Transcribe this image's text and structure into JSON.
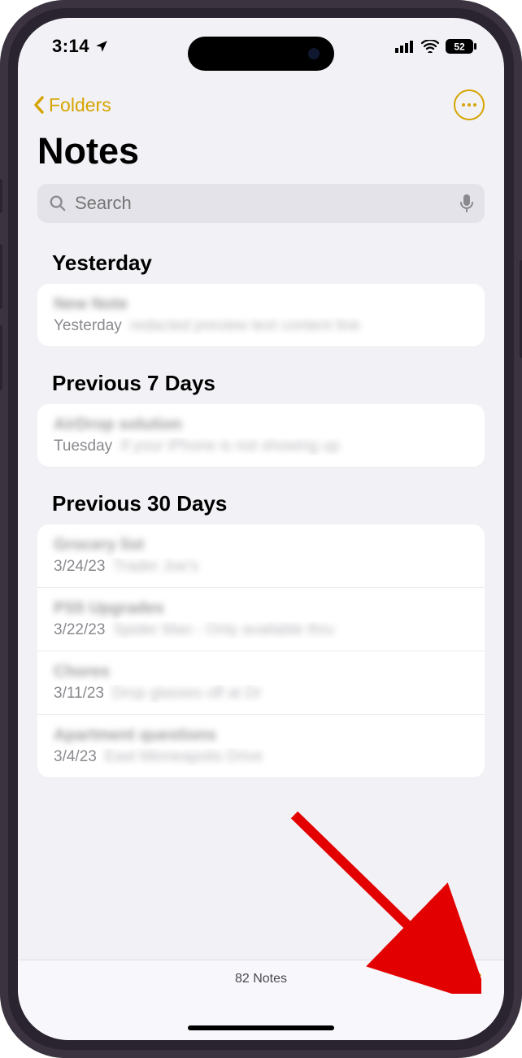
{
  "status": {
    "time": "3:14",
    "battery": "52"
  },
  "nav": {
    "back": "Folders"
  },
  "title": "Notes",
  "search": {
    "placeholder": "Search"
  },
  "sections": [
    {
      "title": "Yesterday",
      "items": [
        {
          "title": "New Note",
          "date": "Yesterday",
          "preview": "redacted preview text content line"
        }
      ]
    },
    {
      "title": "Previous 7 Days",
      "items": [
        {
          "title": "AirDrop solution",
          "date": "Tuesday",
          "preview": "If your iPhone is not showing up"
        }
      ]
    },
    {
      "title": "Previous 30 Days",
      "items": [
        {
          "title": "Grocery list",
          "date": "3/24/23",
          "preview": "Trader Joe's"
        },
        {
          "title": "PS5 Upgrades",
          "date": "3/22/23",
          "preview": "Spider Man - Only available thru"
        },
        {
          "title": "Chores",
          "date": "3/11/23",
          "preview": "Drop glasses off at Dr"
        },
        {
          "title": "Apartment questions",
          "date": "3/4/23",
          "preview": "East Minneapolis Drive"
        }
      ]
    }
  ],
  "toolbar": {
    "count": "82 Notes"
  }
}
